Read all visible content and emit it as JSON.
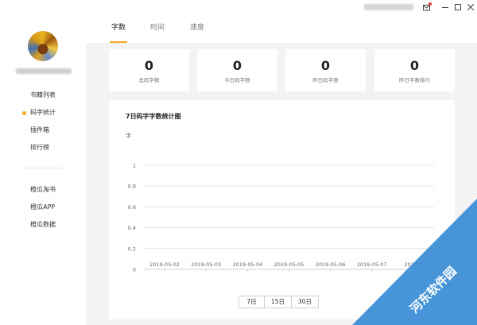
{
  "titlebar": {
    "icons": [
      "mail-icon",
      "minimize-icon",
      "maximize-icon",
      "close-icon"
    ]
  },
  "sidebar": {
    "nav_primary": [
      {
        "label": "书籍列表",
        "active": false
      },
      {
        "label": "码字统计",
        "active": true
      },
      {
        "label": "插件箱",
        "active": false
      },
      {
        "label": "排行榜",
        "active": false
      }
    ],
    "nav_secondary": [
      {
        "label": "橙瓜淘书"
      },
      {
        "label": "橙瓜APP"
      },
      {
        "label": "橙瓜数据"
      }
    ]
  },
  "tabs": [
    {
      "label": "字数",
      "active": true
    },
    {
      "label": "时间",
      "active": false
    },
    {
      "label": "速度",
      "active": false
    }
  ],
  "stats": [
    {
      "value": "0",
      "label": "总码字数"
    },
    {
      "value": "0",
      "label": "今日码字数"
    },
    {
      "value": "0",
      "label": "昨日码字数"
    },
    {
      "value": "0",
      "label": "昨日字数排行"
    }
  ],
  "chart_panel": {
    "title": "7日码字字数统计图",
    "unit": "字",
    "range_buttons": [
      "7日",
      "15日",
      "30日"
    ]
  },
  "chart_data": {
    "type": "line",
    "title": "7日码字字数统计图",
    "ylabel": "字",
    "xlabel": "",
    "categories": [
      "2019-05-02",
      "2019-05-03",
      "2019-05-04",
      "2019-05-05",
      "2019-05-06",
      "2019-05-07",
      "2019-05-08"
    ],
    "x_tick_labels_visible": [
      "2019-05-02",
      "2019-05-03",
      "2019-05-04",
      "2019-05-05",
      "2019-05-06",
      "2019-05-07",
      "2019-0"
    ],
    "series": [
      {
        "values": [
          0,
          0,
          0,
          0,
          0,
          0,
          0
        ]
      }
    ],
    "yticks": [
      "0",
      "0.2",
      "0.4",
      "0.6",
      "0.8",
      "1"
    ],
    "ylim": [
      0,
      1
    ],
    "grid": true,
    "colors": {
      "grid": "#e3e3e3",
      "line": "#f5a623"
    }
  },
  "watermark": {
    "text": "河东软件园"
  },
  "colors": {
    "accent": "#f5a623",
    "watermark": "#3d8fd6"
  }
}
